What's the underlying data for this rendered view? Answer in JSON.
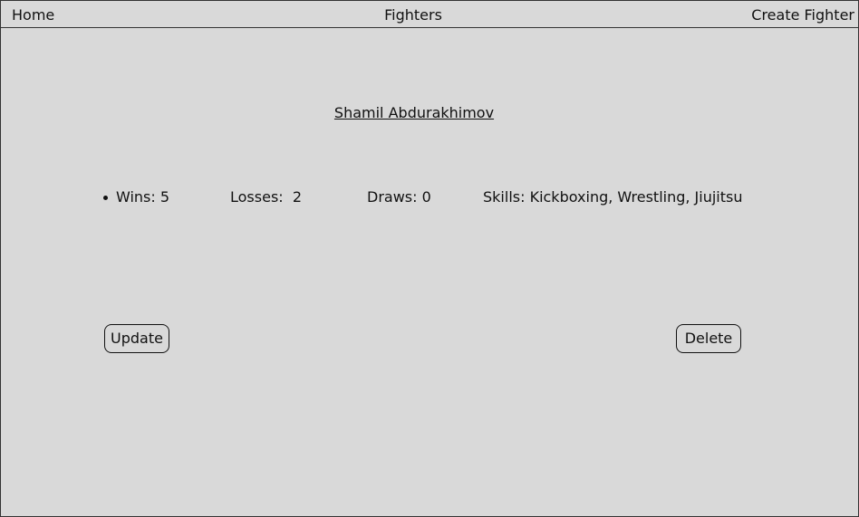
{
  "nav": {
    "home": "Home",
    "fighters": "Fighters",
    "create_fighter": "Create Fighter"
  },
  "fighter": {
    "name": "Shamil Abdurakhimov",
    "wins": "Wins: 5",
    "losses": "Losses:  2",
    "draws": "Draws: 0",
    "skills": "Skills: Kickboxing, Wrestling, Jiujitsu"
  },
  "actions": {
    "update_label": "Update",
    "delete_label": "Delete"
  }
}
